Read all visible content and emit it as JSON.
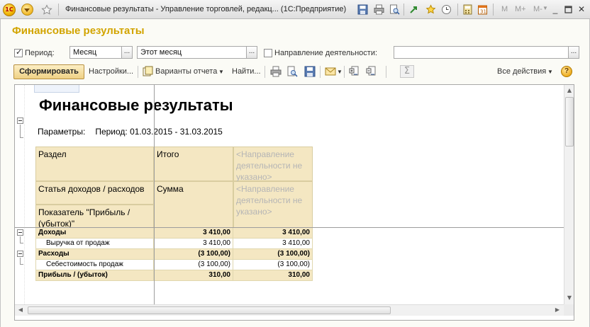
{
  "window": {
    "logo": "1С",
    "title": "Финансовые результаты - Управление торговлей, редакц... (1С:Предприятие)",
    "m_buttons": [
      "M",
      "M+",
      "M-"
    ],
    "icons": [
      "main-menu-icon",
      "favorite-star-icon",
      "save-icon",
      "print-icon",
      "preview-icon",
      "back-forward-icon",
      "favorites-icon",
      "history-icon",
      "calculator-icon",
      "calendar-icon",
      "minimize-icon",
      "maximize-icon",
      "close-icon"
    ]
  },
  "form": {
    "title": "Финансовые результаты",
    "period_label": "Период:",
    "period_checked": true,
    "period_type": "Месяц",
    "period_value": "Этот месяц",
    "direction_label": "Направление деятельности:",
    "direction_checked": false,
    "direction_value": "",
    "ellipsis": "..."
  },
  "toolbar": {
    "generate": "Сформировать",
    "settings": "Настройки...",
    "variants": "Варианты отчета",
    "find": "Найти...",
    "all_actions": "Все действия",
    "help": "?",
    "sum_icon": "Σ"
  },
  "report": {
    "title": "Финансовые результаты",
    "params_label": "Параметры:",
    "params_value": "Период: 01.03.2015 - 31.03.2015",
    "headers": {
      "section": "Раздел",
      "total": "Итого",
      "direction_na": "<Направление деятельности не указано>",
      "article": "Статья доходов / расходов",
      "sum": "Сумма",
      "direction_na2": "<Направление деятельности не указано>",
      "indicator": "Показатель \"Прибыль / (убыток)\""
    },
    "rows": [
      {
        "label": "Доходы",
        "total": "3 410,00",
        "na": "3 410,00"
      },
      {
        "label": "Выручка от продаж",
        "total": "3 410,00",
        "na": "3 410,00"
      },
      {
        "label": "Расходы",
        "total": "(3 100,00)",
        "na": "(3 100,00)"
      },
      {
        "label": "Себестоимость продаж",
        "total": "(3 100,00)",
        "na": "(3 100,00)"
      },
      {
        "label": "Прибыль / (убыток)",
        "total": "310,00",
        "na": "310,00"
      }
    ]
  }
}
